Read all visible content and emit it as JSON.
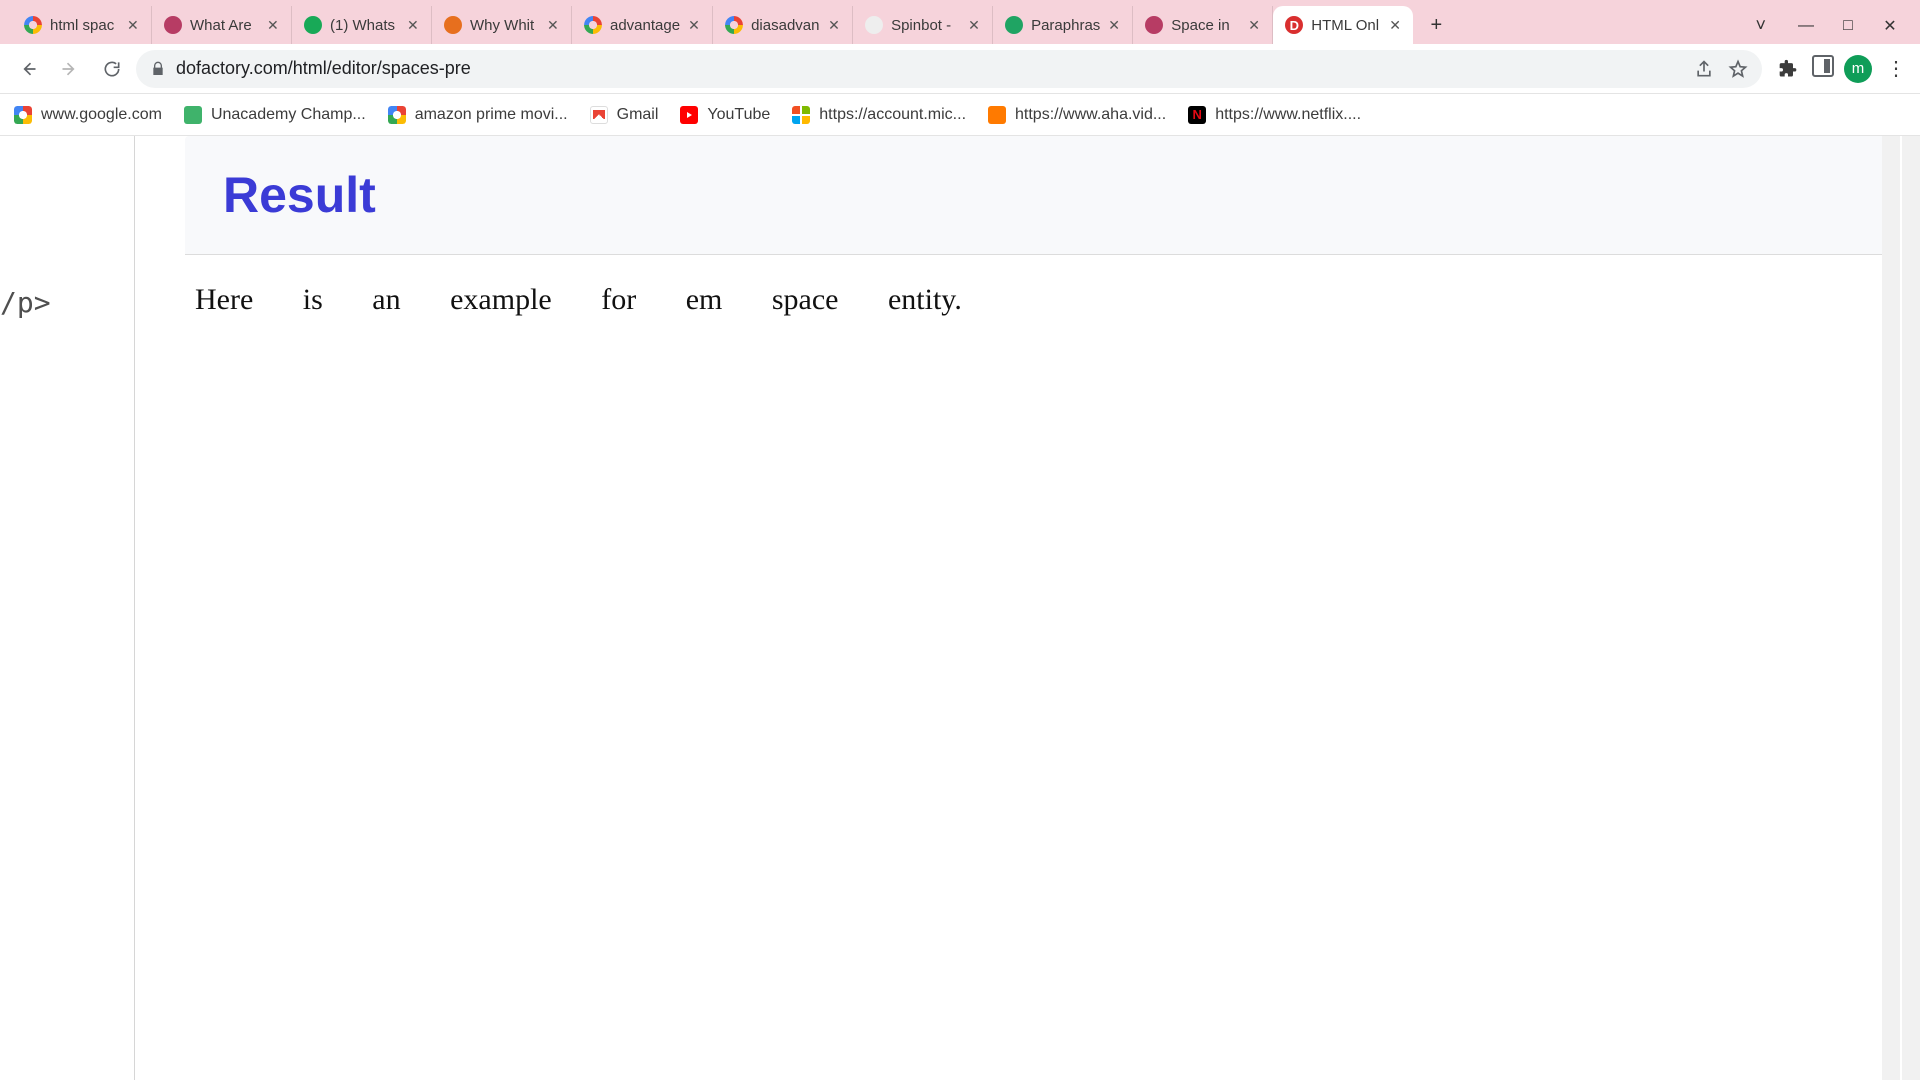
{
  "window": {
    "search_tabs_caret": "˅",
    "minimize": "—",
    "maximize": "□",
    "close": "✕"
  },
  "tabs": [
    {
      "label": "html spac",
      "favicon": "google",
      "active": false
    },
    {
      "label": "What Are",
      "favicon": "pink",
      "active": false
    },
    {
      "label": "(1) Whats",
      "favicon": "green",
      "active": false
    },
    {
      "label": "Why Whit",
      "favicon": "orange",
      "active": false
    },
    {
      "label": "advantage",
      "favicon": "google",
      "active": false
    },
    {
      "label": "diasadvan",
      "favicon": "google",
      "active": false
    },
    {
      "label": "Spinbot -",
      "favicon": "spin",
      "active": false
    },
    {
      "label": "Paraphras",
      "favicon": "greensq",
      "active": false
    },
    {
      "label": "Space in",
      "favicon": "pink",
      "active": false
    },
    {
      "label": "HTML Onl",
      "favicon": "red",
      "active": true
    }
  ],
  "newtab_label": "+",
  "toolbar": {
    "url": "dofactory.com/html/editor/spaces-pre",
    "avatar_letter": "m"
  },
  "bookmarks": [
    {
      "label": "www.google.com",
      "icon": "google"
    },
    {
      "label": "Unacademy Champ...",
      "icon": "unacademy"
    },
    {
      "label": "amazon prime movi...",
      "icon": "google"
    },
    {
      "label": "Gmail",
      "icon": "gmail"
    },
    {
      "label": "YouTube",
      "icon": "yt"
    },
    {
      "label": "https://account.mic...",
      "icon": "ms"
    },
    {
      "label": "https://www.aha.vid...",
      "icon": "aha"
    },
    {
      "label": "https://www.netflix....",
      "icon": "nflx"
    }
  ],
  "page": {
    "editor_fragment": "/p>",
    "result_heading": "Result",
    "result_text": "Here is an example for em space entity."
  }
}
